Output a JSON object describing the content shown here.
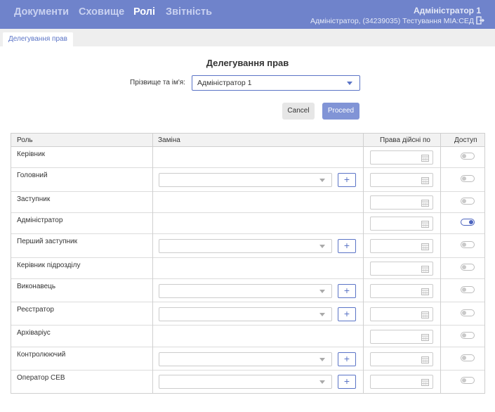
{
  "nav": {
    "items": [
      "Документи",
      "Сховище",
      "Ролі",
      "Звітність"
    ],
    "active": "Ролі"
  },
  "user": {
    "name": "Адміністратор 1",
    "info": "Адміністратор, (34239035) Тестування МІА:СЕД"
  },
  "tab": {
    "label": "Делегування прав"
  },
  "page": {
    "title": "Делегування прав",
    "user_label": "Прізвище та ім'я:",
    "user_value": "Адміністратор 1",
    "cancel_label": "Cancel",
    "proceed_label": "Proceed"
  },
  "table": {
    "columns": {
      "role": "Роль",
      "substitute": "Заміна",
      "valid_until": "Права дійсні по",
      "access": "Доступ"
    },
    "rows": [
      {
        "role": "Керівник",
        "has_substitute": false,
        "access": false
      },
      {
        "role": "Головний",
        "has_substitute": true,
        "access": false
      },
      {
        "role": "Заступник",
        "has_substitute": false,
        "access": false
      },
      {
        "role": "Адміністратор",
        "has_substitute": false,
        "access": true
      },
      {
        "role": "Перший заступник",
        "has_substitute": true,
        "access": false
      },
      {
        "role": "Керівник підрозділу",
        "has_substitute": false,
        "access": false
      },
      {
        "role": "Виконавець",
        "has_substitute": true,
        "access": false
      },
      {
        "role": "Реєстратор",
        "has_substitute": true,
        "access": false
      },
      {
        "role": "Архіваріус",
        "has_substitute": false,
        "access": false
      },
      {
        "role": "Контролюючий",
        "has_substitute": true,
        "access": false
      },
      {
        "role": "Оператор СЕВ",
        "has_substitute": true,
        "access": false
      }
    ],
    "add_label": "+"
  },
  "colors": {
    "topbar": "#6f83cb",
    "accent": "#5b74c6",
    "proceed": "#8194d6"
  },
  "icons": {
    "logout": "logout-icon",
    "calendar": "calendar-icon",
    "dropdown": "chevron-down-icon"
  }
}
